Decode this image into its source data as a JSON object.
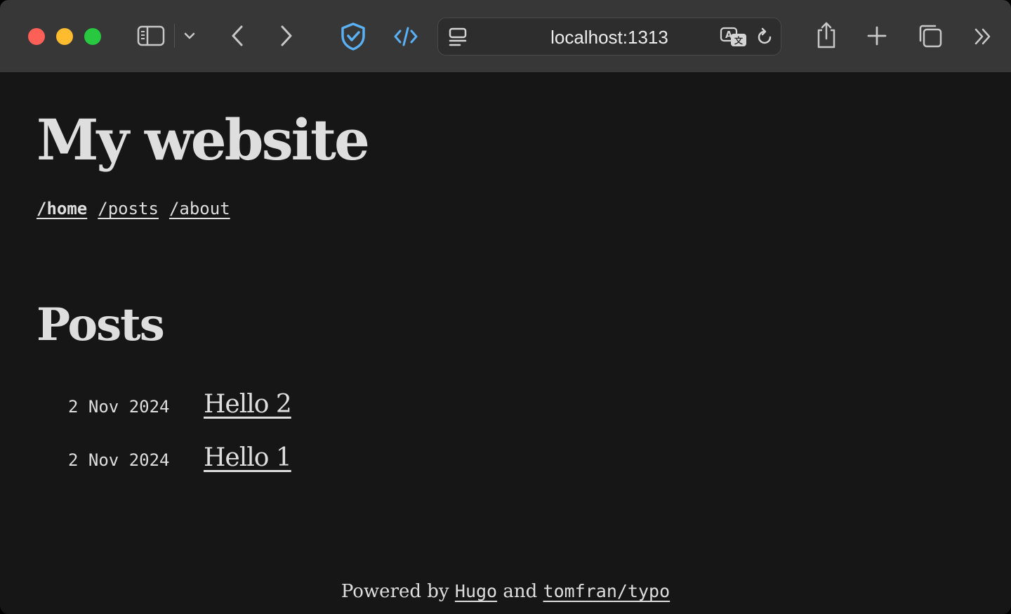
{
  "browser": {
    "url": "localhost:1313",
    "icons": {
      "sidebar": "sidebar-icon",
      "sidebar_menu": "chevron-down-icon",
      "back": "chevron-left-icon",
      "forward": "chevron-right-icon",
      "shield": "shield-check-icon",
      "devtools": "code-icon",
      "page_menu": "page-menu-icon",
      "translate": "translate-icon",
      "reload": "reload-icon",
      "share": "share-icon",
      "new_tab": "plus-icon",
      "tab_overview": "tabs-icon",
      "more": "double-chevron-right-icon"
    },
    "colors": {
      "close": "#fe5f57",
      "minimize": "#febc2e",
      "zoom": "#28c840",
      "accent": "#5ab0f2"
    }
  },
  "site": {
    "title": "My website",
    "nav": [
      {
        "label": "/home",
        "active": true
      },
      {
        "label": "/posts",
        "active": false
      },
      {
        "label": "/about",
        "active": false
      }
    ]
  },
  "main": {
    "heading": "Posts",
    "posts": [
      {
        "date": "2 Nov 2024",
        "title": "Hello 2"
      },
      {
        "date": "2 Nov 2024",
        "title": "Hello 1"
      }
    ]
  },
  "footer": {
    "prefix": "Powered by",
    "link1": "Hugo",
    "middle": "and",
    "link2": "tomfran/typo"
  }
}
